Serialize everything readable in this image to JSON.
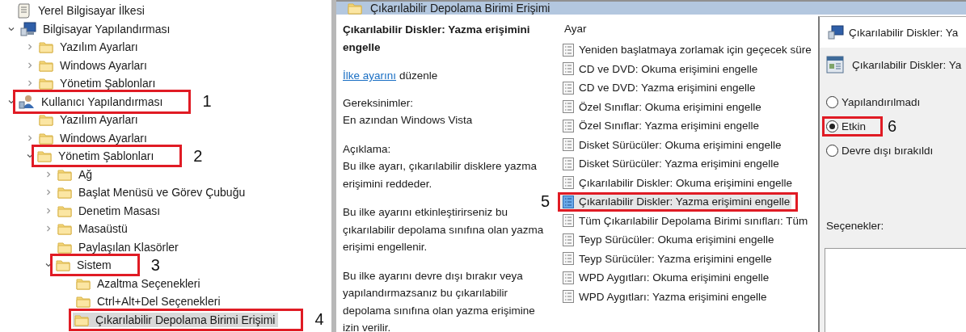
{
  "tree": {
    "label": "Yerel Bilgisayar İlkesi",
    "kind": "policy",
    "selected": false,
    "children": [
      {
        "label": "Bilgisayar Yapılandırması",
        "kind": "computer",
        "expanded": true,
        "selected": false,
        "children": [
          {
            "label": "Yazılım Ayarları",
            "kind": "folder",
            "expanded": false,
            "selected": false
          },
          {
            "label": "Windows Ayarları",
            "kind": "folder",
            "expanded": false,
            "selected": false
          },
          {
            "label": "Yönetim Şablonları",
            "kind": "folder",
            "expanded": false,
            "selected": false
          }
        ]
      },
      {
        "label": "Kullanıcı Yapılandırması",
        "kind": "user",
        "expanded": true,
        "selected": false,
        "callout": "1",
        "children": [
          {
            "label": "Yazılım Ayarları",
            "kind": "folder",
            "selected": false
          },
          {
            "label": "Windows Ayarları",
            "kind": "folder",
            "expanded": false,
            "selected": false
          },
          {
            "label": "Yönetim Şablonları",
            "kind": "folder",
            "expanded": true,
            "selected": false,
            "callout": "2",
            "children": [
              {
                "label": "Ağ",
                "kind": "folder",
                "expanded": false,
                "selected": false
              },
              {
                "label": "Başlat Menüsü ve Görev Çubuğu",
                "kind": "folder",
                "expanded": false,
                "selected": false
              },
              {
                "label": "Denetim Masası",
                "kind": "folder",
                "expanded": false,
                "selected": false
              },
              {
                "label": "Masaüstü",
                "kind": "folder",
                "expanded": false,
                "selected": false
              },
              {
                "label": "Paylaşılan Klasörler",
                "kind": "folder",
                "selected": false
              },
              {
                "label": "Sistem",
                "kind": "folder",
                "expanded": true,
                "selected": false,
                "callout": "3",
                "children": [
                  {
                    "label": "Azaltma Seçenekleri",
                    "kind": "folder",
                    "selected": false
                  },
                  {
                    "label": "Ctrl+Alt+Del Seçenekleri",
                    "kind": "folder",
                    "selected": false
                  },
                  {
                    "label": "Çıkarılabilir Depolama Birimi Erişimi",
                    "kind": "folder",
                    "selected": true,
                    "callout": "4"
                  }
                ]
              }
            ]
          }
        ]
      }
    ]
  },
  "header": {
    "title": "Çıkarılabilir Depolama Birimi Erişimi"
  },
  "description": {
    "title": "Çıkarılabilir Diskler: Yazma erişimini engelle",
    "edit_link": "İlke ayarını",
    "edit_text": "düzenle",
    "paragraphs": [
      "Gereksinimler:\nEn azından Windows Vista",
      "Açıklama:\nBu ilke ayarı, çıkarılabilir disklere yazma erişimini reddeder.",
      "Bu ilke ayarını etkinleştirirseniz bu çıkarılabilir depolama sınıfına olan yazma erişimi engellenir.",
      "Bu ilke ayarını devre dışı bırakır veya yapılandırmazsanız bu çıkarılabilir depolama sınıfına olan yazma erişimine izin verilir."
    ]
  },
  "settings": {
    "column": "Ayar",
    "rows": [
      {
        "label": "Yeniden başlatmaya zorlamak için geçecek süre",
        "selected": false
      },
      {
        "label": "CD ve DVD: Okuma erişimini engelle",
        "selected": false
      },
      {
        "label": "CD ve DVD: Yazma erişimini engelle",
        "selected": false
      },
      {
        "label": "Özel Sınıflar: Okuma erişimini engelle",
        "selected": false
      },
      {
        "label": "Özel Sınıflar: Yazma erişimini engelle",
        "selected": false
      },
      {
        "label": "Disket Sürücüler: Okuma erişimini engelle",
        "selected": false
      },
      {
        "label": "Disket Sürücüler: Yazma erişimini engelle",
        "selected": false
      },
      {
        "label": "Çıkarılabilir Diskler: Okuma erişimini engelle",
        "selected": false
      },
      {
        "label": "Çıkarılabilir Diskler: Yazma erişimini engelle",
        "selected": true,
        "callout": "5"
      },
      {
        "label": "Tüm Çıkarılabilir Depolama Birimi sınıfları: Tüm",
        "selected": false
      },
      {
        "label": "Teyp Sürücüler: Okuma erişimini engelle",
        "selected": false
      },
      {
        "label": "Teyp Sürücüler: Yazma erişimini engelle",
        "selected": false
      },
      {
        "label": "WPD Aygıtları: Okuma erişimini engelle",
        "selected": false
      },
      {
        "label": "WPD Aygıtları: Yazma erişimini engelle",
        "selected": false
      }
    ]
  },
  "dialog": {
    "title": "Çıkarılabilir Diskler: Ya",
    "setting_name": "Çıkarılabilir Diskler: Ya",
    "options": [
      {
        "label": "Yapılandırılmadı",
        "selected": false
      },
      {
        "label": "Etkin",
        "selected": true,
        "callout": "6"
      },
      {
        "label": "Devre dışı bırakıldı",
        "selected": false
      }
    ],
    "options_label": "Seçenekler:"
  }
}
